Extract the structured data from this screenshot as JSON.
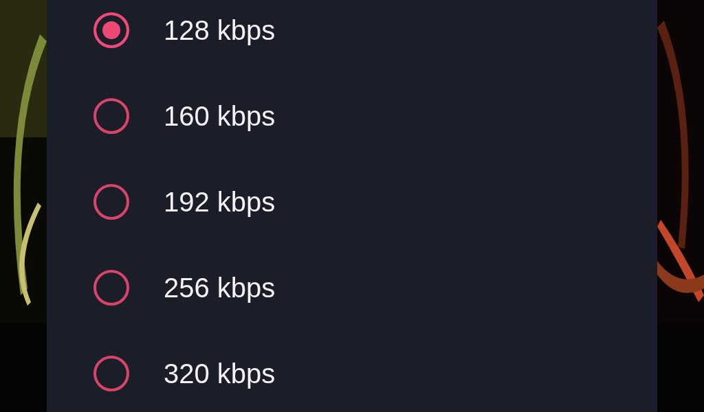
{
  "options": [
    {
      "label": "128 kbps",
      "selected": true
    },
    {
      "label": "160 kbps",
      "selected": false
    },
    {
      "label": "192 kbps",
      "selected": false
    },
    {
      "label": "256 kbps",
      "selected": false
    },
    {
      "label": "320 kbps",
      "selected": false
    }
  ]
}
